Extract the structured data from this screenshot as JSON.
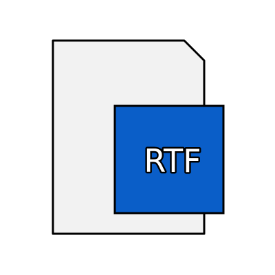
{
  "icon": {
    "name": "rtf-file-icon",
    "label": "RTF",
    "colors": {
      "document_fill": "#f2f2f2",
      "outline": "#000000",
      "badge_fill": "#0a5ec8",
      "label_text": "#ffffff"
    }
  }
}
